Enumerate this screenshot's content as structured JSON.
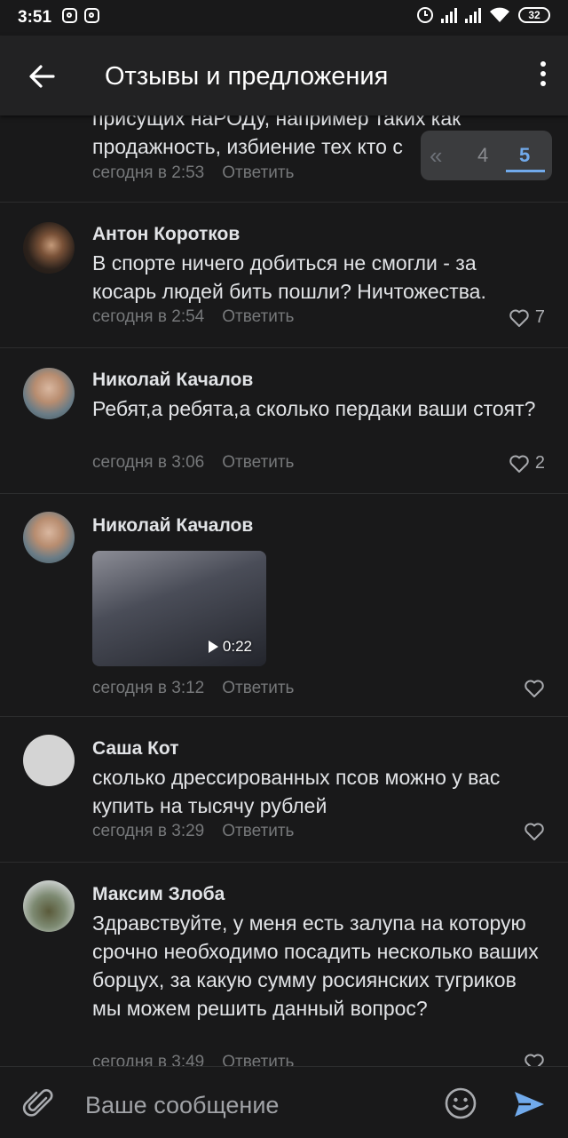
{
  "status_bar": {
    "time": "3:51",
    "battery": "32"
  },
  "header": {
    "title": "Отзывы и предложения"
  },
  "pager": {
    "prev_symbol": "«",
    "pages": [
      "4",
      "5"
    ],
    "current": "5"
  },
  "comments": [
    {
      "author": "",
      "text": "присущих наРОДу, например таких как продажность, избиение тех кто с",
      "time": "сегодня в 2:53",
      "reply_label": "Ответить",
      "likes": ""
    },
    {
      "author": "Антон Коротков",
      "text": "В спорте ничего добиться не смогли - за косарь людей бить пошли? Ничтожества.",
      "time": "сегодня в 2:54",
      "reply_label": "Ответить",
      "likes": "7"
    },
    {
      "author": "Николай Качалов",
      "text": "Ребят,а ребята,а сколько пердаки ваши стоят?",
      "time": "сегодня в 3:06",
      "reply_label": "Ответить",
      "likes": "2"
    },
    {
      "author": "Николай Качалов",
      "text": "",
      "video_duration": "0:22",
      "time": "сегодня в 3:12",
      "reply_label": "Ответить",
      "likes": ""
    },
    {
      "author": "Саша Кот",
      "text": "сколько дрессированных псов можно у вас купить на тысячу рублей",
      "time": "сегодня в 3:29",
      "reply_label": "Ответить",
      "likes": ""
    },
    {
      "author": "Максим Злоба",
      "text": "Здравствуйте, у меня есть залупа на которую срочно необходимо посадить несколько ваших борцух, за какую сумму росиянских тугриков мы можем решить данный вопрос?",
      "time": "сегодня в 3:49",
      "reply_label": "Ответить",
      "likes": ""
    }
  ],
  "composer": {
    "placeholder": "Ваше сообщение"
  },
  "colors": {
    "background": "#19191a",
    "header": "#222223",
    "accent": "#71aaeb",
    "meta_text": "#76787a"
  }
}
